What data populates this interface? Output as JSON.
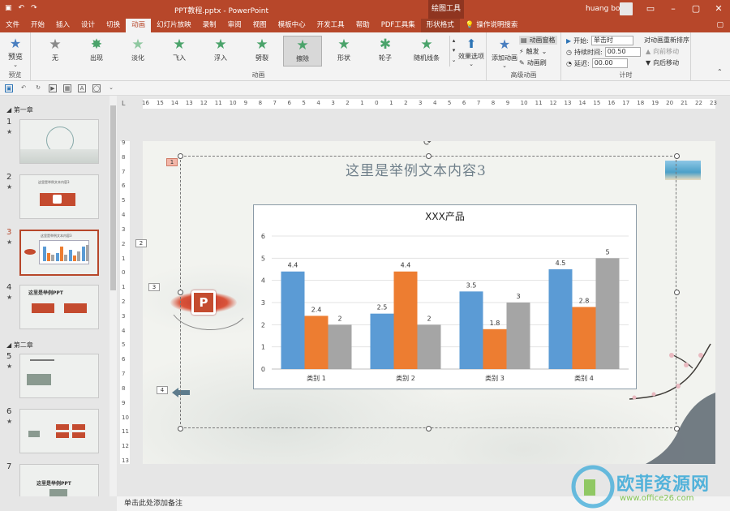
{
  "titlebar": {
    "document_title": "PPT教程.pptx  -  PowerPoint",
    "context_tab": "绘图工具",
    "user": "huang bo",
    "accent": "#b7472a"
  },
  "tabs": [
    {
      "label": "文件"
    },
    {
      "label": "开始"
    },
    {
      "label": "插入"
    },
    {
      "label": "设计"
    },
    {
      "label": "切换"
    },
    {
      "label": "动画",
      "active": true
    },
    {
      "label": "幻灯片放映"
    },
    {
      "label": "录制"
    },
    {
      "label": "审阅"
    },
    {
      "label": "视图"
    },
    {
      "label": "模板中心"
    },
    {
      "label": "开发工具"
    },
    {
      "label": "帮助"
    },
    {
      "label": "PDF工具集"
    },
    {
      "label": "形状格式"
    }
  ],
  "search_tab": "操作说明搜索",
  "ribbon": {
    "preview": {
      "button": "预览",
      "group": "预览"
    },
    "animations": [
      {
        "label": "无"
      },
      {
        "label": "出现"
      },
      {
        "label": "淡化"
      },
      {
        "label": "飞入"
      },
      {
        "label": "浮入"
      },
      {
        "label": "劈裂"
      },
      {
        "label": "擦除",
        "selected": true
      },
      {
        "label": "形状"
      },
      {
        "label": "轮子"
      },
      {
        "label": "随机线条"
      }
    ],
    "effect_options": "效果选项",
    "animation_group": "动画",
    "add_animation": "添加动画",
    "animation_pane": "动画窗格",
    "trigger": "触发",
    "animation_painter": "动画刷",
    "advanced_group": "高级动画",
    "start_label": "开始:",
    "start_value": "单击时",
    "duration_label": "持续时间:",
    "duration_value": "00.50",
    "delay_label": "延迟:",
    "delay_value": "00.00",
    "timing_group": "计时",
    "reorder_title": "对动画重新排序",
    "move_earlier": "向前移动",
    "move_later": "向后移动"
  },
  "thumbnails": {
    "sections": [
      "第一章",
      "第二章"
    ],
    "slides": [
      {
        "num": "1",
        "star": "★"
      },
      {
        "num": "2",
        "star": "★",
        "text": "这里是举例文本内容3"
      },
      {
        "num": "3",
        "star": "★",
        "selected": true,
        "text": "这里是举例文本内容3"
      },
      {
        "num": "4",
        "star": "★",
        "text": "这里是举例PPT"
      },
      {
        "num": "5",
        "star": "★"
      },
      {
        "num": "6",
        "star": "★"
      },
      {
        "num": "7",
        "text": "这里是举例PPT"
      }
    ]
  },
  "hruler_ticks": [
    "16",
    "15",
    "14",
    "13",
    "12",
    "11",
    "10",
    "9",
    "8",
    "7",
    "6",
    "5",
    "4",
    "3",
    "2",
    "1",
    "0",
    "1",
    "2",
    "3",
    "4",
    "5",
    "6",
    "7",
    "8",
    "9",
    "10",
    "11",
    "12",
    "13",
    "14",
    "15",
    "16",
    "17",
    "18",
    "19",
    "20",
    "21",
    "22",
    "23"
  ],
  "vruler_ticks": [
    "9",
    "8",
    "7",
    "6",
    "5",
    "4",
    "3",
    "2",
    "1",
    "0",
    "1",
    "2",
    "3",
    "4",
    "5",
    "6",
    "7",
    "8",
    "9",
    "10",
    "11",
    "12",
    "13"
  ],
  "slide": {
    "title": "这里是举例文本内容3",
    "anim_badges": [
      "1",
      "2",
      "3",
      "4"
    ]
  },
  "chart_data": {
    "type": "bar",
    "title": "XXX产品",
    "categories": [
      "类别 1",
      "类别 2",
      "类别 3",
      "类别 4"
    ],
    "series": [
      {
        "values": [
          4.4,
          2.5,
          3.5,
          4.5
        ],
        "color": "#5b9bd5"
      },
      {
        "values": [
          2.4,
          4.4,
          1.8,
          2.8
        ],
        "color": "#ed7d31"
      },
      {
        "values": [
          2,
          2,
          3,
          5
        ],
        "color": "#a5a5a5"
      }
    ],
    "ylim": [
      0,
      6
    ],
    "yticks": [
      "0",
      "1",
      "2",
      "3",
      "4",
      "5",
      "6"
    ],
    "grid": true
  },
  "notes_placeholder": "单击此处添加备注",
  "watermark": {
    "text": "欧菲资源网",
    "url": "www.office26.com"
  }
}
